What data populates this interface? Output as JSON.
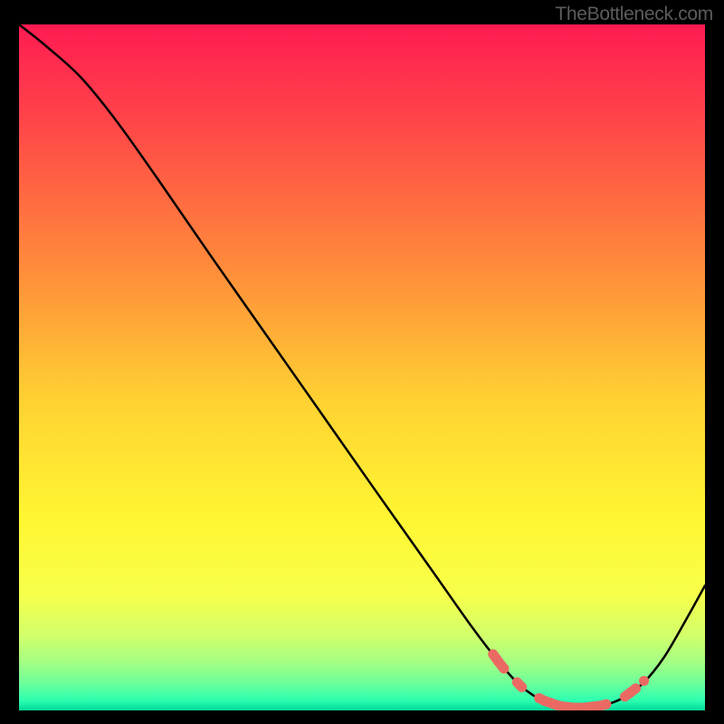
{
  "watermark": "TheBottleneck.com",
  "chart_data": {
    "type": "line",
    "title": "",
    "xlabel": "",
    "ylabel": "",
    "xlim": [
      0,
      100
    ],
    "ylim": [
      0,
      100
    ],
    "curve": [
      {
        "x": 0.0,
        "y": 100.0
      },
      {
        "x": 4.0,
        "y": 96.8
      },
      {
        "x": 9.0,
        "y": 92.3
      },
      {
        "x": 14.0,
        "y": 86.2
      },
      {
        "x": 20.0,
        "y": 77.8
      },
      {
        "x": 28.0,
        "y": 66.2
      },
      {
        "x": 36.0,
        "y": 54.8
      },
      {
        "x": 44.0,
        "y": 43.4
      },
      {
        "x": 52.0,
        "y": 32.0
      },
      {
        "x": 60.0,
        "y": 20.7
      },
      {
        "x": 66.0,
        "y": 12.2
      },
      {
        "x": 70.0,
        "y": 7.0
      },
      {
        "x": 73.0,
        "y": 3.7
      },
      {
        "x": 76.0,
        "y": 1.6
      },
      {
        "x": 79.0,
        "y": 0.6
      },
      {
        "x": 82.0,
        "y": 0.4
      },
      {
        "x": 85.0,
        "y": 0.7
      },
      {
        "x": 88.0,
        "y": 1.8
      },
      {
        "x": 91.0,
        "y": 4.0
      },
      {
        "x": 94.0,
        "y": 7.7
      },
      {
        "x": 97.0,
        "y": 12.8
      },
      {
        "x": 100.0,
        "y": 18.2
      }
    ],
    "marker_segments": [
      [
        {
          "x": 69.1,
          "y": 8.2
        },
        {
          "x": 69.9,
          "y": 7.1
        },
        {
          "x": 70.7,
          "y": 6.1
        }
      ],
      [
        {
          "x": 72.6,
          "y": 4.1
        },
        {
          "x": 73.3,
          "y": 3.4
        }
      ],
      [
        {
          "x": 75.8,
          "y": 1.8
        },
        {
          "x": 76.6,
          "y": 1.4
        },
        {
          "x": 77.5,
          "y": 1.1
        },
        {
          "x": 78.3,
          "y": 0.8
        },
        {
          "x": 79.1,
          "y": 0.6
        },
        {
          "x": 79.9,
          "y": 0.5
        },
        {
          "x": 80.7,
          "y": 0.4
        },
        {
          "x": 81.5,
          "y": 0.4
        },
        {
          "x": 82.4,
          "y": 0.4
        },
        {
          "x": 83.2,
          "y": 0.5
        },
        {
          "x": 84.0,
          "y": 0.6
        },
        {
          "x": 84.8,
          "y": 0.7
        },
        {
          "x": 85.6,
          "y": 0.9
        }
      ],
      [
        {
          "x": 88.3,
          "y": 2.0
        },
        {
          "x": 89.1,
          "y": 2.6
        },
        {
          "x": 89.9,
          "y": 3.2
        }
      ],
      [
        {
          "x": 91.1,
          "y": 4.3
        }
      ]
    ],
    "marker_color": "#ea6a63",
    "gradient_stops": [
      {
        "offset": 0.0,
        "color": "#ff1b52"
      },
      {
        "offset": 0.15,
        "color": "#ff4848"
      },
      {
        "offset": 0.35,
        "color": "#ff8a3b"
      },
      {
        "offset": 0.55,
        "color": "#ffd232"
      },
      {
        "offset": 0.72,
        "color": "#fff632"
      },
      {
        "offset": 0.83,
        "color": "#f7ff4a"
      },
      {
        "offset": 0.89,
        "color": "#d2ff6a"
      },
      {
        "offset": 0.93,
        "color": "#a4ff84"
      },
      {
        "offset": 0.96,
        "color": "#6dff9a"
      },
      {
        "offset": 0.985,
        "color": "#2effb0"
      },
      {
        "offset": 1.0,
        "color": "#00d99a"
      }
    ]
  }
}
